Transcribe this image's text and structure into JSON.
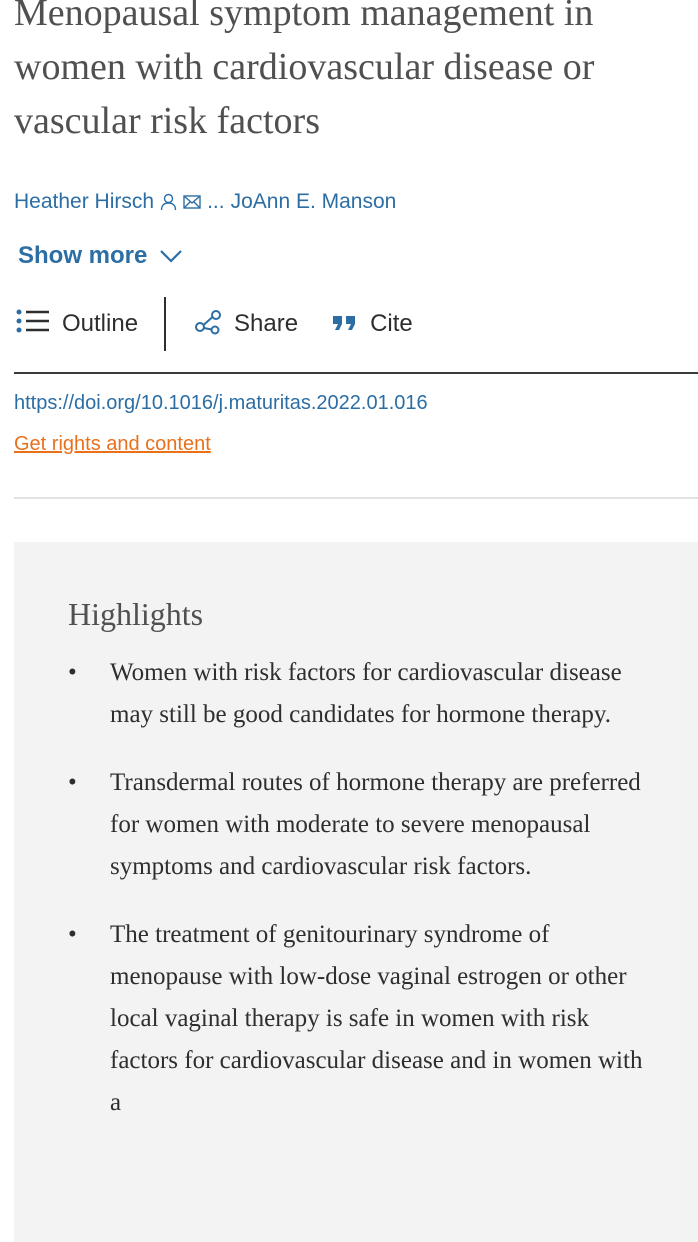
{
  "article": {
    "title": "Menopausal symptom management in women with cardiovascular disease or vascular risk factors",
    "author_first": "Heather Hirsch",
    "author_separator": "...",
    "author_last": "JoAnn E. Manson",
    "show_more_label": "Show more"
  },
  "actions": {
    "outline_label": "Outline",
    "share_label": "Share",
    "cite_label": "Cite"
  },
  "links": {
    "doi": "https://doi.org/10.1016/j.maturitas.2022.01.016",
    "rights": "Get rights and content"
  },
  "highlights": {
    "title": "Highlights",
    "bullet": "•",
    "items": [
      "Women with risk factors for cardiovascular disease may still be good candidates for hormone therapy.",
      "Transdermal routes of hormone therapy are preferred for women with moderate to severe menopausal symptoms and cardiovascular risk factors.",
      "The treatment of genitourinary syndrome of menopause with low-dose vaginal estrogen or other local vaginal therapy is safe in women with risk factors for cardiovascular disease and in women with a"
    ]
  },
  "colors": {
    "link_blue": "#2c6ea4",
    "rights_orange": "#e9711c",
    "highlights_bg": "#f3f3f3",
    "title_gray": "#505050"
  },
  "icons": [
    "person-icon",
    "envelope-icon",
    "chevron-down-icon",
    "outline-list-icon",
    "share-icon",
    "quote-icon"
  ]
}
